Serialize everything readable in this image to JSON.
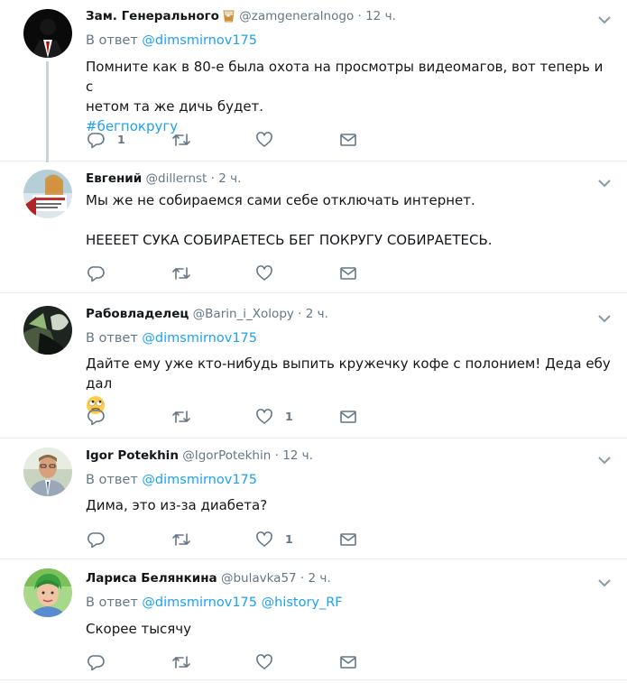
{
  "tweets": [
    {
      "name": "Зам. Генерального",
      "handle": "@zamgeneralnogo",
      "time": "12 ч.",
      "reply_label": "В ответ",
      "mentions": [
        "@dimsmirnov175"
      ],
      "text_lines": [
        "Помните как в 80-е была охота на просмотры видеомагов, вот теперь и с",
        "нетом та же дичь будет."
      ],
      "hashtag": "#бегпокругу",
      "reply_count": "1",
      "like_count": ""
    },
    {
      "name": "Евгений",
      "handle": "@dillernst",
      "time": "2 ч.",
      "text_lines": [
        "Мы же не собираемся сами себе отключать интернет.",
        "",
        "НЕЕЕЕТ СУКА СОБИРАЕТЕСЬ БЕГ ПОКРУГУ СОБИРАЕТЕСЬ."
      ],
      "reply_count": "",
      "like_count": ""
    },
    {
      "name": "Рабовладелец",
      "handle": "@Barin_i_Xolopy",
      "time": "2 ч.",
      "reply_label": "В ответ",
      "mentions": [
        "@dimsmirnov175"
      ],
      "text_lines": [
        "Дайте ему уже кто-нибудь выпить кружечку кофе с полонием! Деда ебу дал"
      ],
      "reply_count": "",
      "like_count": "1"
    },
    {
      "name": "Igor Potekhin",
      "handle": "@IgorPotekhin",
      "time": "12 ч.",
      "reply_label": "В ответ",
      "mentions": [
        "@dimsmirnov175"
      ],
      "text_lines": [
        "Дима, это из-за диабета?"
      ],
      "reply_count": "",
      "like_count": "1"
    },
    {
      "name": "Лариса Белянкина",
      "handle": "@bulavka57",
      "time": "2 ч.",
      "reply_label": "В ответ",
      "mentions": [
        "@dimsmirnov175",
        "@history_RF"
      ],
      "text_lines": [
        "Скорее тысячу"
      ],
      "reply_count": "",
      "like_count": ""
    }
  ],
  "icons": {
    "reply": "reply-icon",
    "retweet": "retweet-icon",
    "like": "heart-icon",
    "dm": "envelope-icon",
    "more": "chevron-down-icon"
  },
  "colors": {
    "link": "#1da1f2",
    "muted": "#657786",
    "text": "#14171a",
    "divider": "#e6ecf0",
    "thread_line": "#c7d3dd"
  }
}
